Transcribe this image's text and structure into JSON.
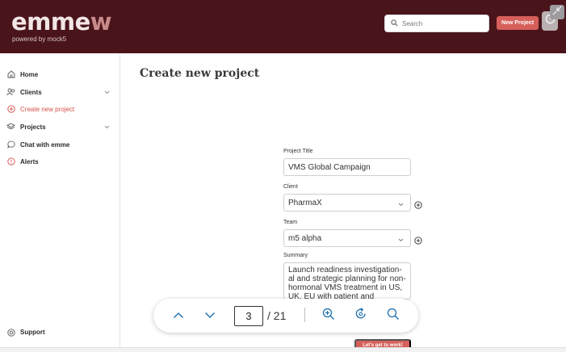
{
  "header": {
    "logo_main": "emme",
    "logo_tail": "w",
    "tagline": "powered by mock5",
    "search_placeholder": "Search",
    "new_project_label": "New Project"
  },
  "sidebar": {
    "items": [
      {
        "label": "Home",
        "icon": "home-icon"
      },
      {
        "label": "Clients",
        "icon": "users-icon"
      },
      {
        "label": "Create new project",
        "icon": "plus-circle-icon"
      },
      {
        "label": "Projects",
        "icon": "layers-icon"
      },
      {
        "label": "Chat with emme",
        "icon": "chat-icon"
      },
      {
        "label": "Alerts",
        "icon": "alert-icon"
      }
    ],
    "support_label": "Support"
  },
  "main": {
    "title": "Create new project",
    "form": {
      "project_title_label": "Project Title",
      "project_title_value": "VMS Global Campaign",
      "client_label": "Client",
      "client_value": "PharmaX",
      "team_label": "Team",
      "team_value": "m5 alpha",
      "summary_label": "Summary",
      "summary_value": "Launch readiness investigation-al and strategic planning for non-hormonal VMS treatment in US, UK, EU with patient and",
      "submit_label": "Let's get to work!"
    }
  },
  "viewer": {
    "current_page": "3",
    "total_pages": "/ 21"
  },
  "colors": {
    "header_bg": "#4a141b",
    "accent": "#d65f5a",
    "active_nav": "#d6504a"
  }
}
